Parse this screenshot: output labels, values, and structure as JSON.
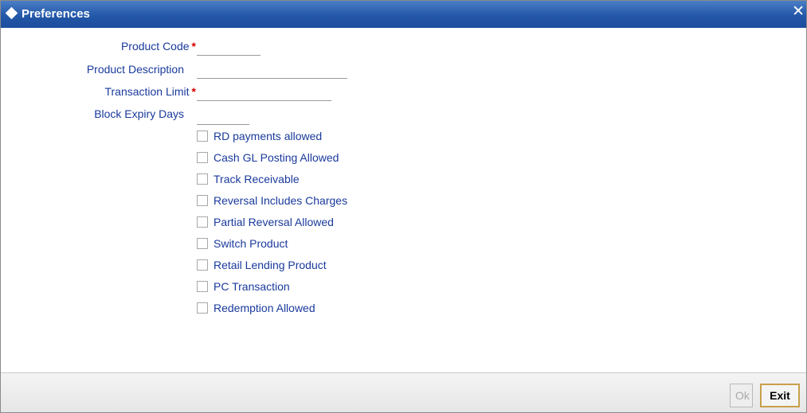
{
  "window": {
    "title": "Preferences",
    "close_glyph": "✕"
  },
  "fields": {
    "product_code": {
      "label": "Product Code",
      "required": "*",
      "value": ""
    },
    "product_description": {
      "label": "Product Description",
      "value": ""
    },
    "transaction_limit": {
      "label": "Transaction Limit",
      "required": "*",
      "value": ""
    },
    "block_expiry_days": {
      "label": "Block Expiry Days",
      "value": ""
    }
  },
  "checkboxes": [
    {
      "label": "RD payments allowed",
      "checked": false
    },
    {
      "label": "Cash GL Posting Allowed",
      "checked": false
    },
    {
      "label": "Track Receivable",
      "checked": false
    },
    {
      "label": "Reversal Includes Charges",
      "checked": false
    },
    {
      "label": "Partial Reversal Allowed",
      "checked": false
    },
    {
      "label": "Switch Product",
      "checked": false
    },
    {
      "label": "Retail Lending Product",
      "checked": false
    },
    {
      "label": "PC Transaction",
      "checked": false
    },
    {
      "label": "Redemption Allowed",
      "checked": false
    }
  ],
  "buttons": {
    "ok": "Ok",
    "exit": "Exit"
  },
  "colors": {
    "title_bar": "#2457a8",
    "label": "#1a3a9c",
    "required": "#d80000",
    "exit_border": "#c8a04a"
  }
}
